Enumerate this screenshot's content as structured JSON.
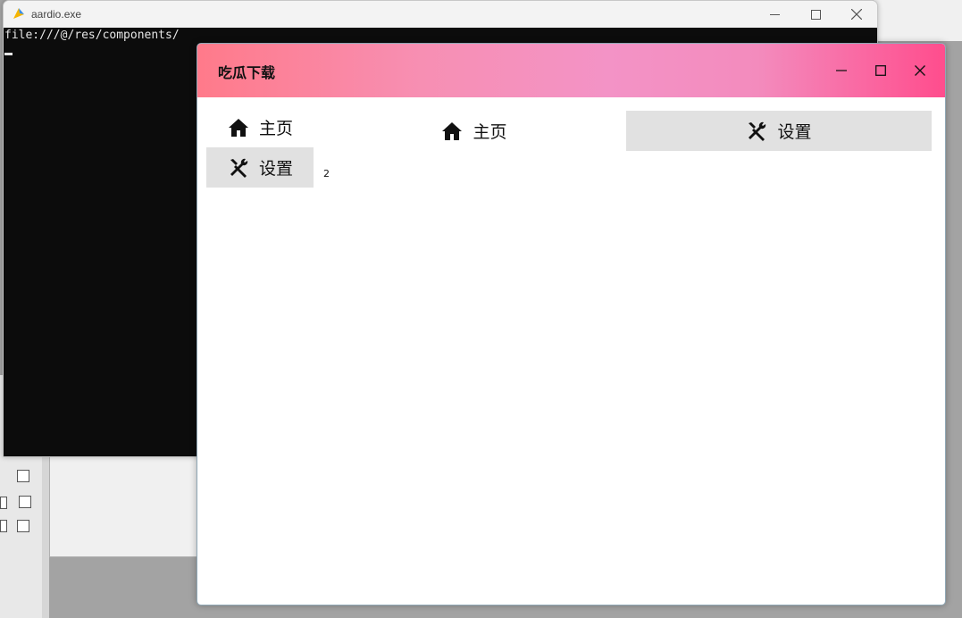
{
  "console_window": {
    "title": "aardio.exe",
    "output_line": "file:///@/res/components/"
  },
  "app_window": {
    "title": "吃瓜下载",
    "sidebar": {
      "items": [
        {
          "label": "主页",
          "icon": "home-icon"
        },
        {
          "label": "设置",
          "icon": "tools-icon"
        }
      ],
      "count": "2"
    },
    "tabs": [
      {
        "label": "主页",
        "icon": "home-icon"
      },
      {
        "label": "设置",
        "icon": "tools-icon"
      }
    ]
  },
  "colors": {
    "title_gradient_start": "#ff7a8a",
    "title_gradient_end": "#ff4d8d",
    "selected_bg": "#e1e1e1",
    "console_bg": "#0c0c0c"
  }
}
